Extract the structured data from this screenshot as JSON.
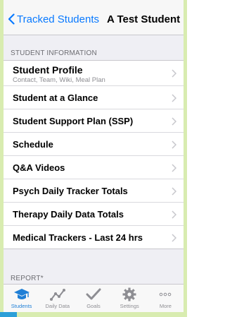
{
  "navbar": {
    "back_label": "Tracked Students",
    "title": "A Test Student"
  },
  "sections": [
    {
      "header": "STUDENT INFORMATION",
      "items": [
        {
          "title": "Student Profile",
          "subtitle": "Contact, Team, Wiki, Meal Plan"
        },
        {
          "title": "Student at a Glance"
        },
        {
          "title": "Student Support Plan (SSP)"
        },
        {
          "title": "Schedule"
        },
        {
          "title": "Q&A Videos"
        },
        {
          "title": "Psych Daily Tracker Totals"
        },
        {
          "title": "Therapy Daily Data Totals"
        },
        {
          "title": "Medical Trackers - Last 24 hrs"
        }
      ]
    },
    {
      "header": "REPORT*"
    }
  ],
  "tabbar": {
    "tabs": [
      {
        "label": "Students",
        "icon": "graduation-cap-icon",
        "active": true
      },
      {
        "label": "Daily Data",
        "icon": "line-graph-icon",
        "active": false
      },
      {
        "label": "Goals",
        "icon": "checkmark-icon",
        "active": false
      },
      {
        "label": "Settings",
        "icon": "gear-icon",
        "active": false
      },
      {
        "label": "More",
        "icon": "more-dots-icon",
        "active": false
      }
    ]
  },
  "colors": {
    "accent": "#0a7aff",
    "active_tab": "#1f7fd6",
    "inactive_tab": "#8e8e93",
    "frame": "#d8ecb0"
  }
}
